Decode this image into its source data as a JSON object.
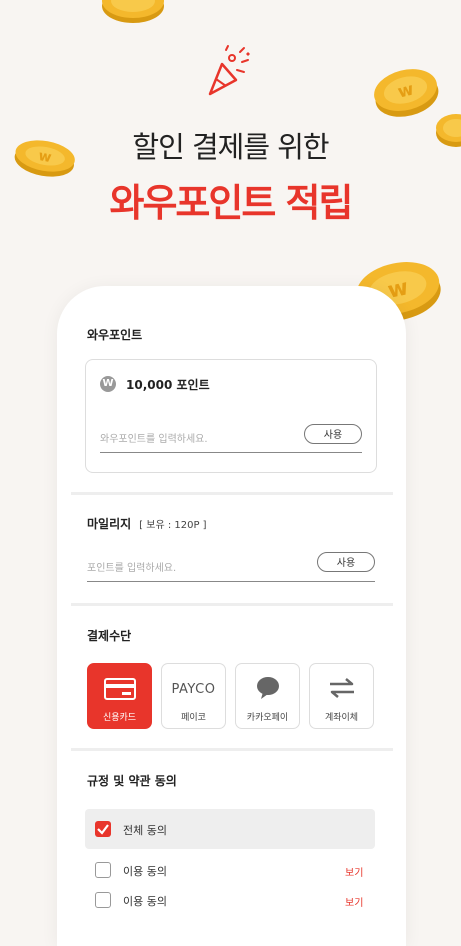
{
  "hero": {
    "subtitle": "할인 결제를 위한",
    "title": "와우포인트 적립"
  },
  "colors": {
    "accent": "#e8352b",
    "coin": "#f4b82c",
    "background": "#f8f5f2"
  },
  "wow_point": {
    "section_title": "와우포인트",
    "badge_letter": "W",
    "amount": "10,000 포인트",
    "placeholder": "와우포인트를 입력하세요.",
    "use_button": "사용"
  },
  "mileage": {
    "section_title": "마일리지",
    "holding": "[ 보유 : 120P ]",
    "placeholder": "포인트를 입력하세요.",
    "use_button": "사용"
  },
  "payment": {
    "section_title": "결제수단",
    "methods": [
      {
        "label": "신용카드",
        "icon": "credit-card-icon",
        "selected": true
      },
      {
        "label": "페이코",
        "logo_text": "PAYCO",
        "selected": false
      },
      {
        "label": "카카오페이",
        "icon": "speech-bubble-icon",
        "selected": false
      },
      {
        "label": "계좌이체",
        "icon": "transfer-arrows-icon",
        "selected": false
      }
    ]
  },
  "terms": {
    "section_title": "규정 및 약관 동의",
    "all_agree": "전체 동의",
    "items": [
      {
        "label": "이용 동의",
        "view": "보기"
      },
      {
        "label": "이용 동의",
        "view": "보기"
      }
    ]
  }
}
